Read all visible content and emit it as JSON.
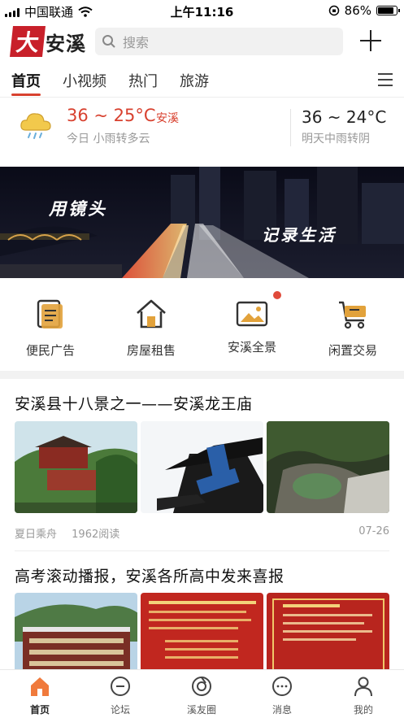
{
  "status_bar": {
    "carrier": "中国联通",
    "time": "上午11:16",
    "battery_percent": "86%",
    "battery_level": 0.86
  },
  "header": {
    "logo_mark": "大",
    "logo_text": "安溪",
    "search_placeholder": "搜索",
    "plus_icon": "plus-icon"
  },
  "tabs": [
    {
      "label": "首页",
      "active": true
    },
    {
      "label": "小视频",
      "active": false
    },
    {
      "label": "热门",
      "active": false
    },
    {
      "label": "旅游",
      "active": false
    }
  ],
  "weather": {
    "today_temp": "36 ~ 25°C",
    "city": "安溪",
    "today_desc": "今日 小雨转多云",
    "tomorrow_temp": "36 ~ 24°C",
    "tomorrow_desc": "明天中雨转阴"
  },
  "banner": {
    "caption_left": "用镜头",
    "caption_right": "记录生活"
  },
  "services": [
    {
      "label": "便民广告",
      "icon": "document-icon"
    },
    {
      "label": "房屋租售",
      "icon": "house-icon"
    },
    {
      "label": "安溪全景",
      "icon": "image-icon",
      "badge": true
    },
    {
      "label": "闲置交易",
      "icon": "cart-icon"
    }
  ],
  "articles": [
    {
      "title": "安溪县十八景之一——安溪龙王庙",
      "author": "夏日乘舟",
      "reads": "1962阅读",
      "date": "07-26"
    },
    {
      "title": "高考滚动播报，安溪各所高中发来喜报"
    }
  ],
  "bottom_nav": [
    {
      "label": "首页",
      "icon": "home-icon",
      "active": true
    },
    {
      "label": "论坛",
      "icon": "forum-icon",
      "active": false
    },
    {
      "label": "溪友圈",
      "icon": "circle-icon",
      "active": false
    },
    {
      "label": "消息",
      "icon": "message-icon",
      "active": false
    },
    {
      "label": "我的",
      "icon": "user-icon",
      "active": false
    }
  ],
  "colors": {
    "accent": "#d8412f",
    "logo_red": "#c8202a",
    "home_orange": "#f07a3c",
    "service_gold": "#e2a23b"
  }
}
